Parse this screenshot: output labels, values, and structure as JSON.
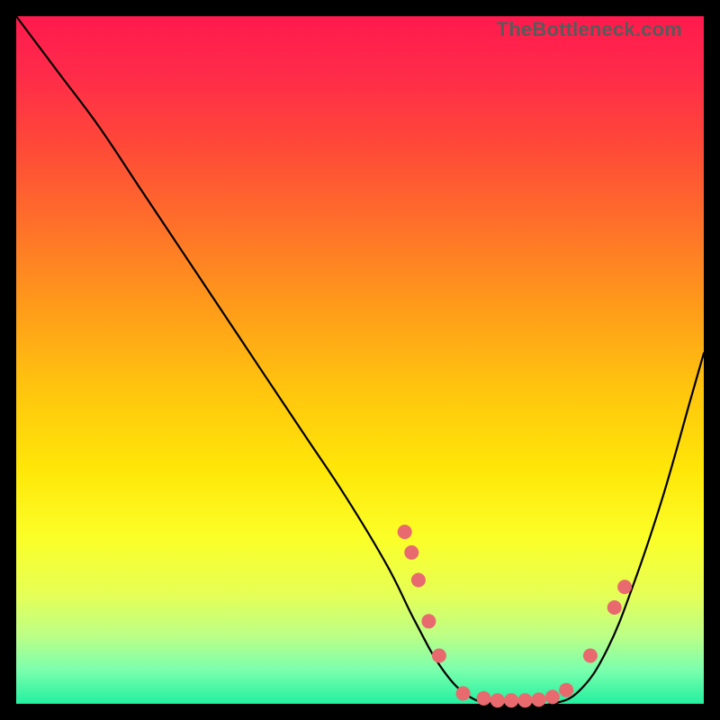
{
  "watermark": "TheBottleneck.com",
  "colors": {
    "dot": "#e86a6f",
    "curve": "#000000"
  },
  "chart_data": {
    "type": "line",
    "title": "",
    "xlabel": "",
    "ylabel": "",
    "xlim": [
      0,
      100
    ],
    "ylim": [
      0,
      100
    ],
    "series": [
      {
        "name": "bottleneck-curve",
        "x": [
          0,
          6,
          12,
          18,
          24,
          30,
          36,
          42,
          48,
          54,
          58,
          62,
          66,
          70,
          74,
          78,
          82,
          86,
          90,
          94,
          98,
          100
        ],
        "y": [
          100,
          92,
          84,
          75,
          66,
          57,
          48,
          39,
          30,
          20,
          12,
          5,
          1,
          0,
          0,
          0,
          2,
          8,
          18,
          30,
          44,
          51
        ]
      }
    ],
    "highlighted_points": [
      {
        "x": 56.5,
        "y": 25
      },
      {
        "x": 57.5,
        "y": 22
      },
      {
        "x": 58.5,
        "y": 18
      },
      {
        "x": 60.0,
        "y": 12
      },
      {
        "x": 61.5,
        "y": 7
      },
      {
        "x": 65.0,
        "y": 1.5
      },
      {
        "x": 68.0,
        "y": 0.8
      },
      {
        "x": 70.0,
        "y": 0.5
      },
      {
        "x": 72.0,
        "y": 0.5
      },
      {
        "x": 74.0,
        "y": 0.5
      },
      {
        "x": 76.0,
        "y": 0.6
      },
      {
        "x": 78.0,
        "y": 1.0
      },
      {
        "x": 80.0,
        "y": 2.0
      },
      {
        "x": 83.5,
        "y": 7.0
      },
      {
        "x": 87.0,
        "y": 14
      },
      {
        "x": 88.5,
        "y": 17
      }
    ],
    "dot_radius_px": 8
  }
}
